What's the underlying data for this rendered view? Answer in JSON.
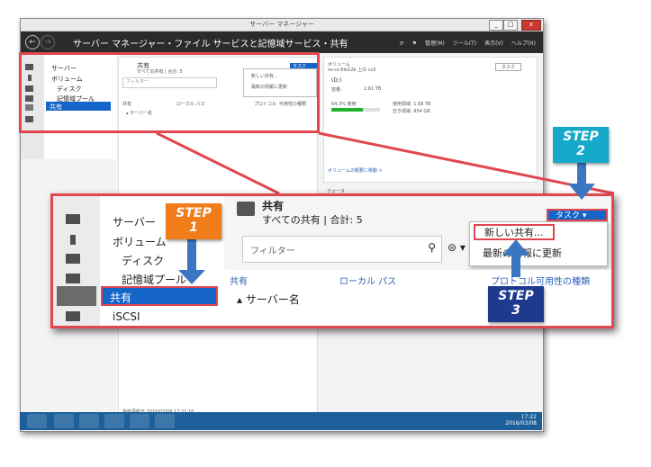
{
  "window": {
    "title": "サーバー マネージャー",
    "breadcrumb": "サーバー マネージャー・ファイル サービスと記憶域サービス・共有",
    "menus": [
      "管理(M)",
      "ツール(T)",
      "表示(V)",
      "ヘルプ(H)"
    ],
    "minimize": "_",
    "maximize": "□",
    "close": "x"
  },
  "sidebar": {
    "items": [
      {
        "label": "サーバー"
      },
      {
        "label": "ボリューム"
      },
      {
        "label": "ディスク"
      },
      {
        "label": "記憶域プール"
      },
      {
        "label": "共有"
      },
      {
        "label": "iSCSI"
      }
    ],
    "selected": "共有"
  },
  "shares_tile": {
    "title": "共有",
    "subtitle": "すべての共有 | 合計: 5",
    "tasks_button": "タスク",
    "filter_placeholder": "フィルター",
    "columns": [
      "共有",
      "ローカル パス",
      "プロトコル",
      "可用性の種類"
    ],
    "group_row": "サーバー名",
    "menu": [
      "新しい共有...",
      "最新の情報に更新"
    ],
    "footer": "最終更新日 2016/03/08 17:21:10"
  },
  "volume_tile": {
    "title": "ボリューム",
    "subtitle": "sv-cs-file12b 上の cs3",
    "tasks_button": "タスク",
    "drive": "(D:)",
    "capacity_label": "容量:",
    "capacity_value": "2.61 TB",
    "used_percent_text": "64.3% 使用",
    "used_fraction": 0.643,
    "used_space": "使用領域: 1.68 TB",
    "free_space": "空き領域: 954 GB",
    "link": "ボリュームの概要に移動 >",
    "quota_title": "クォータ"
  },
  "steps": [
    {
      "word": "STEP",
      "num": "1",
      "color": "#f07d1a"
    },
    {
      "word": "STEP",
      "num": "2",
      "color": "#16a9c9"
    },
    {
      "word": "STEP",
      "num": "3",
      "color": "#1d3a8f"
    }
  ],
  "taskbar": {
    "time": "17:22",
    "date": "2016/03/08"
  }
}
